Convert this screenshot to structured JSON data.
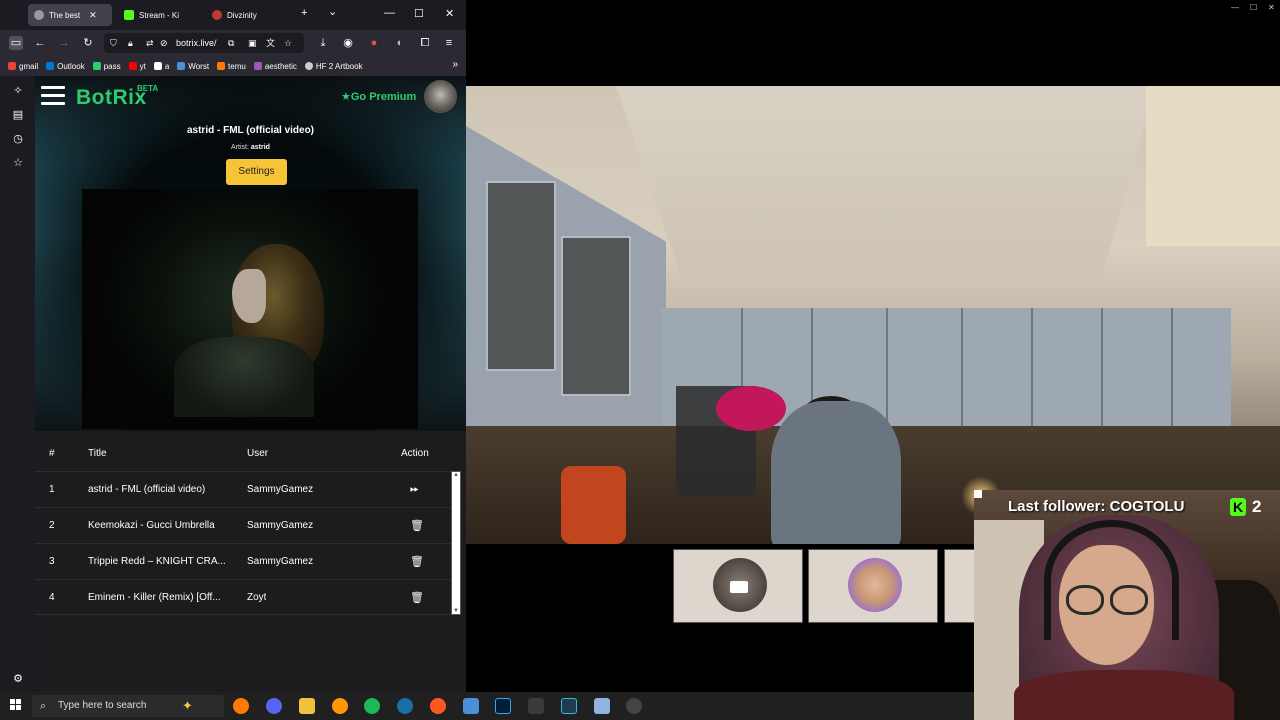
{
  "browser": {
    "tabs": [
      {
        "label": "The best",
        "active": true
      },
      {
        "label": "Stream - Ki",
        "active": false
      },
      {
        "label": "Divzinity",
        "active": false
      }
    ],
    "new_tab": "+",
    "tab_list": "⌄",
    "url": "botrix.live/",
    "bookmarks": [
      {
        "label": "gmail",
        "color": "#ea4335"
      },
      {
        "label": "Outlook",
        "color": "#0078d4"
      },
      {
        "label": "pass",
        "color": "#2ecc71"
      },
      {
        "label": "yt",
        "color": "#ff0000"
      },
      {
        "label": "a",
        "color": "#ffffff"
      },
      {
        "label": "Worst",
        "color": "#4a90d9"
      },
      {
        "label": "temu",
        "color": "#ff7a00"
      },
      {
        "label": "aesthetic",
        "color": "#9b59b6"
      },
      {
        "label": "HF 2 Artbook",
        "color": "#cccccc"
      }
    ]
  },
  "site": {
    "logo": "BotRix",
    "beta": "BETA",
    "premium": "Go Premium",
    "now_playing": {
      "title": "astrid - FML (official video)",
      "artist_label": "Artist:",
      "artist": "astrid"
    },
    "settings_button": "Settings",
    "queue": {
      "headers": {
        "num": "#",
        "title": "Title",
        "user": "User",
        "action": "Action"
      },
      "rows": [
        {
          "num": "1",
          "title": "astrid - FML (official video)",
          "user": "SammyGamez",
          "action": "skip"
        },
        {
          "num": "2",
          "title": "Keemokazi - Gucci Umbrella",
          "user": "SammyGamez",
          "action": "delete"
        },
        {
          "num": "3",
          "title": "Trippie Redd – KNIGHT CRA...",
          "user": "SammyGamez",
          "action": "delete"
        },
        {
          "num": "4",
          "title": "Eminem - Killer (Remix) [Off...",
          "user": "Zoyt",
          "action": "delete"
        }
      ]
    }
  },
  "overlay": {
    "last_follower": "Last follower: COGTOLU",
    "kick_count": "2",
    "kick_logo": "K"
  },
  "taskbar": {
    "search_placeholder": "Type here to search"
  },
  "colors": {
    "brand_green": "#2ecc71",
    "settings_yellow": "#f6c437",
    "kick_green": "#53fc18",
    "page_bg": "#1c1c1e"
  }
}
